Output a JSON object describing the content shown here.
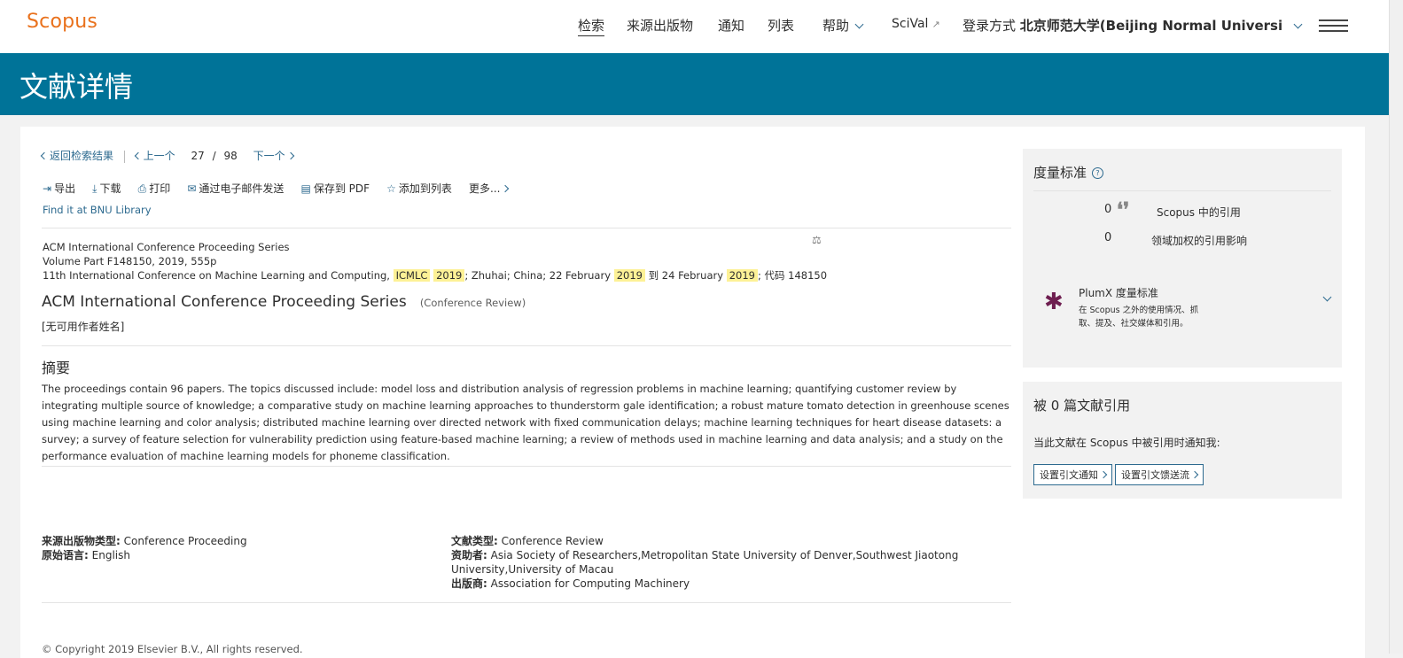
{
  "header": {
    "logo": "Scopus",
    "nav": {
      "search": "检索",
      "sources": "来源出版物",
      "alerts": "通知",
      "lists": "列表",
      "help": "帮助",
      "scival": "SciVal",
      "login_prefix": "登录方式",
      "institution": "北京师范大学(Beijing Normal Universi"
    }
  },
  "banner": {
    "title": "文献详情"
  },
  "navigation": {
    "back": "返回检索结果",
    "prev": "上一个",
    "position": "27",
    "slash": "/",
    "total": "98",
    "next": "下一个"
  },
  "toolbar": {
    "export": "导出",
    "download": "下载",
    "print": "打印",
    "email": "通过电子邮件发送",
    "save_pdf": "保存到 PDF",
    "add_list": "添加到列表",
    "more": "更多..."
  },
  "library_link": "Find it at BNU Library",
  "source": {
    "series": "ACM International Conference Proceeding Series",
    "volume": "Volume Part F148150, 2019, 555p",
    "conf_prefix": "11th International Conference on Machine Learning and Computing,",
    "hl_icmlc": "ICMLC",
    "hl_2019a": "2019",
    "conf_mid": "; Zhuhai; China; 22 February",
    "hl_2019b": "2019",
    "conf_mid2": "到 24 February",
    "hl_2019c": "2019",
    "conf_suffix": "; 代码 148150"
  },
  "document": {
    "title": "ACM International Conference Proceeding Series",
    "type": "(Conference Review)",
    "authors": "[无可用作者姓名]"
  },
  "abstract": {
    "heading": "摘要",
    "text": "The proceedings contain 96 papers. The topics discussed include: model loss and distribution analysis of regression problems in machine learning; quantifying customer review by integrating multiple source of knowledge; a comparative study on machine learning approaches to thunderstorm gale identification; a robust mature tomato detection in greenhouse scenes using machine learning and color analysis; distributed machine learning over directed network with fixed communication delays; machine learning techniques for heart disease datasets: a survey; a survey of feature selection for vulnerability prediction using feature-based machine learning; a review of methods used in machine learning and data analysis; and a study on the performance evaluation of machine learning models for phoneme classification."
  },
  "meta": {
    "source_type_label": "来源出版物类型:",
    "source_type": "Conference Proceeding",
    "language_label": "原始语言:",
    "language": "English",
    "doc_type_label": "文献类型:",
    "doc_type": "Conference Review",
    "sponsor_label": "资助者:",
    "sponsor": "Asia Society of Researchers,Metropolitan State University of Denver,Southwest Jiaotong University,University of Macau",
    "publisher_label": "出版商:",
    "publisher": "Association for Computing Machinery"
  },
  "footer_partial": "© Copyright 2019 Elsevier B.V., All rights reserved.",
  "metrics": {
    "heading": "度量标准",
    "q": "?",
    "citations_count": "0",
    "citations_label": "Scopus 中的引用",
    "fwci_count": "0",
    "fwci_label": "领域加权的引用影响",
    "plumx_title": "PlumX 度量标准",
    "plumx_desc": "在 Scopus 之外的使用情况、抓取、提及、社交媒体和引用。"
  },
  "cited_by": {
    "heading": "被 0 篇文献引用",
    "desc": "当此文献在 Scopus 中被引用时通知我:",
    "btn_alert": "设置引文通知",
    "btn_feed": "设置引文馈送流"
  },
  "colors": {
    "brand_orange": "#e9711c",
    "banner_teal": "#007398",
    "link_blue": "#2d6a8f",
    "highlight": "#fdf196",
    "plumx": "#6e1e50"
  }
}
